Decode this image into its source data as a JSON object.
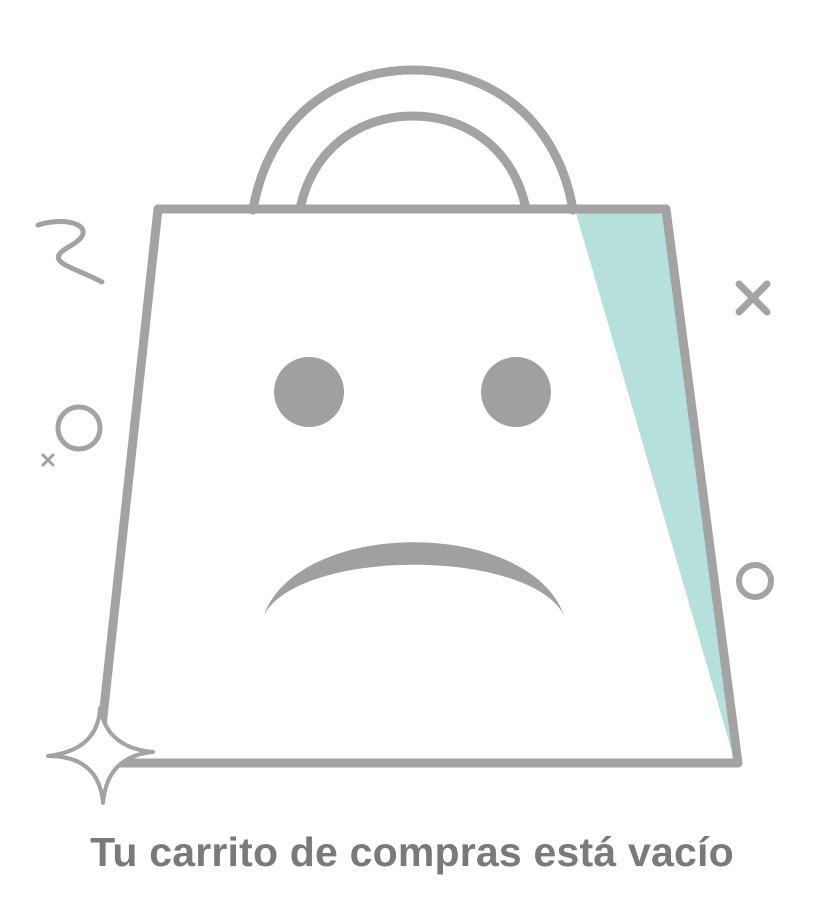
{
  "empty_cart": {
    "message": "Tu carrito de compras está vacío",
    "illustration_icon": "sad-shopping-bag-icon"
  },
  "colors": {
    "outline_gray": "#a3a3a3",
    "face_gray": "#a0a0a0",
    "accent_teal": "#b5e0dc",
    "text_gray": "#7a7a7a",
    "background": "#ffffff"
  }
}
